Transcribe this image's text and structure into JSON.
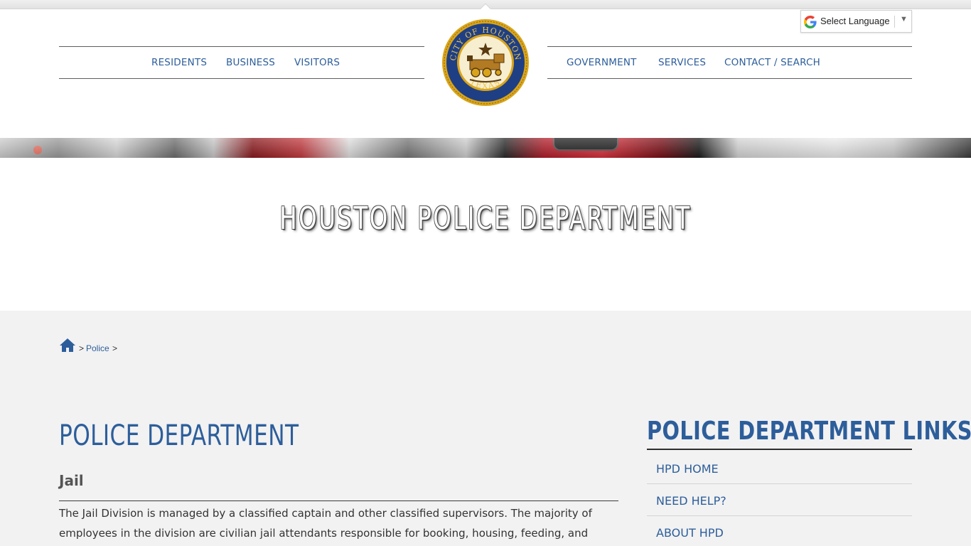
{
  "header": {
    "nav_left": [
      "RESIDENTS",
      "BUSINESS",
      "VISITORS"
    ],
    "nav_right": [
      "GOVERNMENT",
      "SERVICES",
      "CONTACT / SEARCH"
    ],
    "seal": {
      "top_text": "CITY OF HOUSTON",
      "bottom_text": "TEXAS",
      "colors": {
        "ring": "#1f3f85",
        "gold": "#d9a41a",
        "inner": "#f7eed0"
      }
    },
    "language": {
      "label": "Select Language",
      "arrow": "▼",
      "icon": "google-g-icon"
    }
  },
  "banner": {
    "title": "HOUSTON POLICE DEPARTMENT"
  },
  "breadcrumb": {
    "home_icon": "home-icon",
    "separator": ">",
    "items": [
      "Police"
    ]
  },
  "main": {
    "title": "POLICE DEPARTMENT",
    "subtitle": "Jail",
    "body": "The Jail Division is managed by a classified captain and other classified supervisors. The majority of employees in the division are civilian jail attendants responsible for booking, housing, feeding, and"
  },
  "sidebar": {
    "title": "POLICE DEPARTMENT LINKS",
    "links": [
      "HPD HOME",
      "NEED HELP?",
      "ABOUT HPD"
    ]
  },
  "colors": {
    "link_blue": "#2d5e9b",
    "page_bg": "#f2f2f2"
  }
}
